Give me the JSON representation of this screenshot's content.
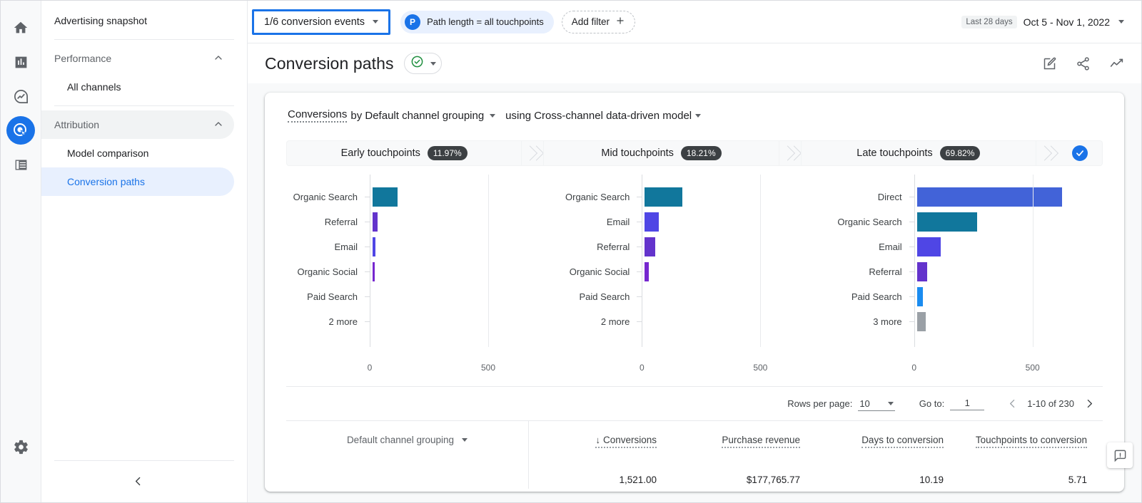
{
  "rail": {
    "items": [
      {
        "name": "home-icon",
        "label": "Home"
      },
      {
        "name": "reports-icon",
        "label": "Reports"
      },
      {
        "name": "explore-icon",
        "label": "Explore"
      },
      {
        "name": "advertising-icon",
        "label": "Advertising"
      },
      {
        "name": "configure-icon",
        "label": "Configure"
      }
    ],
    "settings_label": "Admin",
    "active_index": 3,
    "active_color": "#1a73e8"
  },
  "sidebar": {
    "snapshot_label": "Advertising snapshot",
    "groups": [
      {
        "label": "Performance",
        "expanded": true,
        "items": [
          {
            "label": "All channels",
            "selected": false
          }
        ]
      },
      {
        "label": "Attribution",
        "expanded": true,
        "items": [
          {
            "label": "Model comparison",
            "selected": false
          },
          {
            "label": "Conversion paths",
            "selected": true
          }
        ]
      }
    ],
    "collapse_label": "Collapse navigation"
  },
  "toolbar": {
    "conversion_events": "1/6 conversion events",
    "path_length_filter": "Path length = all touchpoints",
    "path_length_badge": "P",
    "add_filter": "Add filter",
    "date_preset": "Last 28 days",
    "date_range": "Oct 5 - Nov 1, 2022"
  },
  "header": {
    "title": "Conversion paths",
    "status_icon": "check-circle-icon",
    "actions": [
      {
        "name": "edit-comparison-icon",
        "label": "Edit"
      },
      {
        "name": "share-icon",
        "label": "Share this report"
      },
      {
        "name": "insights-icon",
        "label": "Insights"
      }
    ]
  },
  "card": {
    "heading": {
      "metric": "Conversions",
      "by": "by Default channel grouping",
      "using": "using Cross-channel data-driven model"
    },
    "stages": [
      {
        "label": "Early touchpoints",
        "pct": "11.97%"
      },
      {
        "label": "Mid touchpoints",
        "pct": "18.21%"
      },
      {
        "label": "Late touchpoints",
        "pct": "69.82%"
      }
    ],
    "stage_end_icon": "conversion-check-icon"
  },
  "chart_data": [
    {
      "type": "bar",
      "title": "Early touchpoints",
      "orientation": "horizontal",
      "xlabel": "",
      "ylabel": "",
      "xlim": [
        0,
        500
      ],
      "ticks": [
        "0",
        "500"
      ],
      "grid": true,
      "categories": [
        "Organic Search",
        "Referral",
        "Email",
        "Organic Social",
        "Paid Search",
        "2 more"
      ],
      "values": [
        105,
        21,
        12,
        6,
        0,
        0
      ],
      "colors": [
        "#11779c",
        "#6333cc",
        "#4f46e5",
        "#7627cf",
        "#1a73e8",
        "#9aa0a6"
      ]
    },
    {
      "type": "bar",
      "title": "Mid touchpoints",
      "orientation": "horizontal",
      "xlabel": "",
      "ylabel": "",
      "xlim": [
        0,
        500
      ],
      "ticks": [
        "0",
        "500"
      ],
      "grid": true,
      "categories": [
        "Organic Search",
        "Email",
        "Referral",
        "Organic Social",
        "Paid Search",
        "2 more"
      ],
      "values": [
        160,
        60,
        45,
        18,
        0,
        0
      ],
      "colors": [
        "#11779c",
        "#4f46e5",
        "#6333cc",
        "#7627cf",
        "#1a73e8",
        "#9aa0a6"
      ]
    },
    {
      "type": "bar",
      "title": "Late touchpoints",
      "orientation": "horizontal",
      "xlabel": "",
      "ylabel": "",
      "xlim": [
        0,
        500
      ],
      "ticks": [
        "0",
        "500"
      ],
      "grid": true,
      "categories": [
        "Direct",
        "Organic Search",
        "Email",
        "Referral",
        "Paid Search",
        "3 more"
      ],
      "values": [
        611,
        253,
        99,
        42,
        24,
        36
      ],
      "colors": [
        "#4263d8",
        "#11779c",
        "#4f46e5",
        "#6333cc",
        "#1a8cf0",
        "#9aa0a6"
      ]
    }
  ],
  "pagination": {
    "rows_per_page_label": "Rows per page:",
    "rows_per_page_value": "10",
    "goto_label": "Go to:",
    "goto_value": "1",
    "range": "1-10 of 230"
  },
  "table": {
    "dimension": "Default channel grouping",
    "columns": [
      {
        "label": "Conversions",
        "sorted": true,
        "sort_glyph": "↓"
      },
      {
        "label": "Purchase revenue",
        "sorted": false,
        "sort_glyph": ""
      },
      {
        "label": "Days to conversion",
        "sorted": false,
        "sort_glyph": ""
      },
      {
        "label": "Touchpoints to conversion",
        "sorted": false,
        "sort_glyph": ""
      }
    ],
    "totals": [
      "1,521.00",
      "$177,765.77",
      "10.19",
      "5.71"
    ]
  },
  "feedback": {
    "label": "Send feedback",
    "icon": "feedback-icon"
  }
}
